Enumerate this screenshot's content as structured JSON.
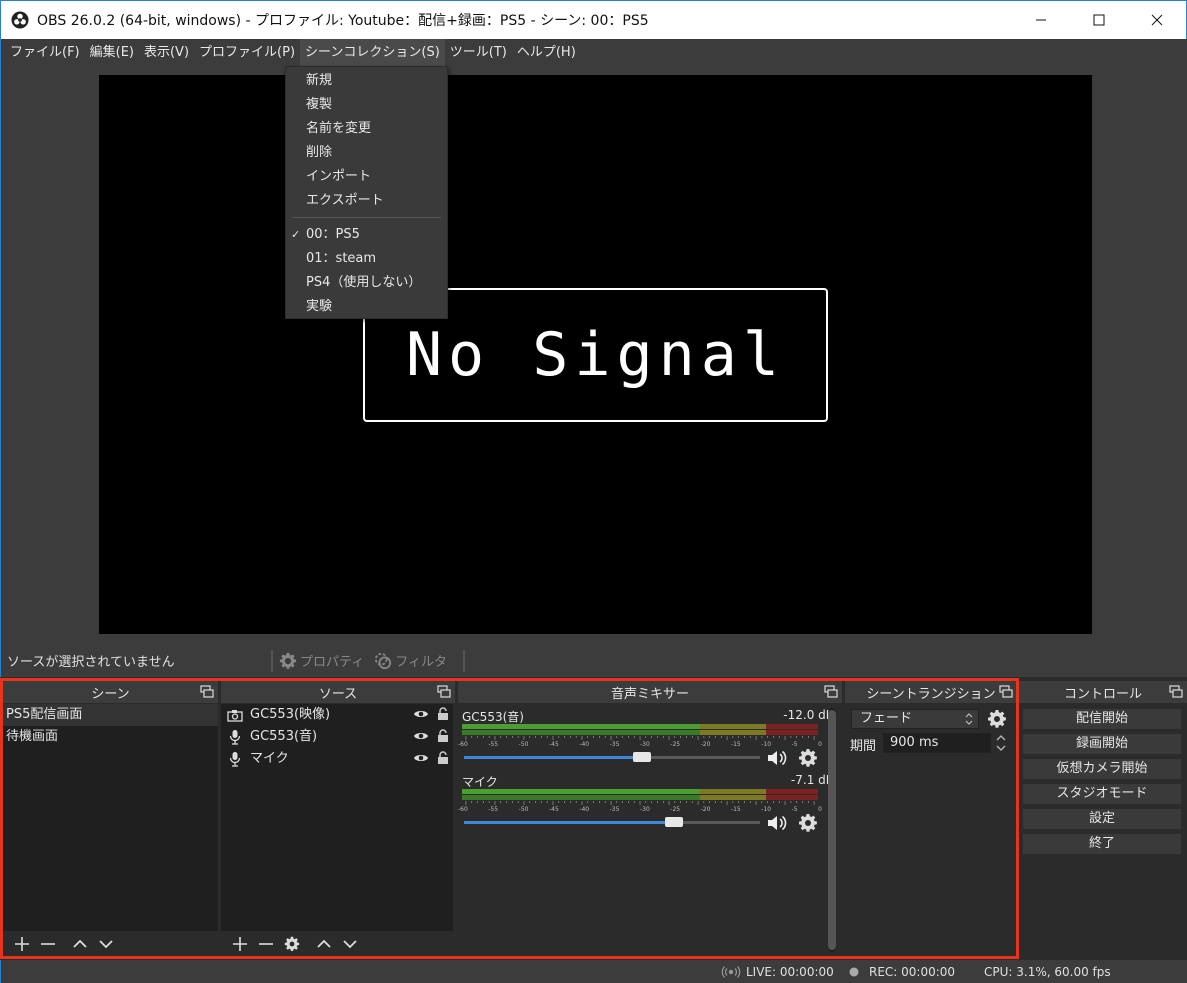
{
  "window": {
    "title": "OBS 26.0.2 (64-bit, windows) - プロファイル: Youtube：配信+録画：PS5 - シーン: 00：PS5",
    "minimize": "—",
    "maximize": "☐",
    "close": "✕"
  },
  "menubar": [
    {
      "label": "ファイル(F)"
    },
    {
      "label": "編集(E)"
    },
    {
      "label": "表示(V)"
    },
    {
      "label": "プロファイル(P)"
    },
    {
      "label": "シーンコレクション(S)"
    },
    {
      "label": "ツール(T)"
    },
    {
      "label": "ヘルプ(H)"
    }
  ],
  "scene_collection_menu": {
    "actions": [
      "新規",
      "複製",
      "名前を変更",
      "削除",
      "インポート",
      "エクスポート"
    ],
    "collections": [
      {
        "label": "00：PS5",
        "checked": true,
        "check": "✓"
      },
      {
        "label": "01：steam",
        "checked": false
      },
      {
        "label": "PS4（使用しない）",
        "checked": false
      },
      {
        "label": "実験",
        "checked": false
      }
    ]
  },
  "preview": {
    "text": "No Signal"
  },
  "source_toolbar": {
    "no_selection": "ソースが選択されていません",
    "properties": "プロパティ",
    "filters": "フィルタ"
  },
  "scenes": {
    "title": "シーン",
    "items": [
      "PS5配信画面",
      "待機画面"
    ]
  },
  "sources": {
    "title": "ソース",
    "items": [
      {
        "label": "GC553(映像)",
        "icon": "camera-icon"
      },
      {
        "label": "GC553(音)",
        "icon": "microphone-icon"
      },
      {
        "label": "マイク",
        "icon": "microphone-icon"
      }
    ]
  },
  "mixer": {
    "title": "音声ミキサー",
    "tick_labels": [
      "-60",
      "-55",
      "-50",
      "-45",
      "-40",
      "-35",
      "-30",
      "-25",
      "-20",
      "-15",
      "-10",
      "-5",
      "0"
    ],
    "channels": [
      {
        "name": "GC553(音)",
        "db": "-12.0 dB",
        "volume_fraction": 0.6
      },
      {
        "name": "マイク",
        "db": "-7.1 dB",
        "volume_fraction": 0.71
      }
    ]
  },
  "transitions": {
    "title": "シーントランジション",
    "selected": "フェード",
    "duration_label": "期間",
    "duration_value": "900 ms"
  },
  "controls": {
    "title": "コントロール",
    "buttons": [
      "配信開始",
      "録画開始",
      "仮想カメラ開始",
      "スタジオモード",
      "設定",
      "終了"
    ]
  },
  "statusbar": {
    "live": "LIVE: 00:00:00",
    "rec": "REC: 00:00:00",
    "cpu": "CPU: 3.1%, 60.00 fps"
  },
  "colors": {
    "highlight_frame": "#e8341c",
    "slider_fill": "#3f86d6",
    "meter_green": "#4c9d33",
    "meter_yellow": "#7c7a22",
    "meter_red": "#7c2222"
  }
}
